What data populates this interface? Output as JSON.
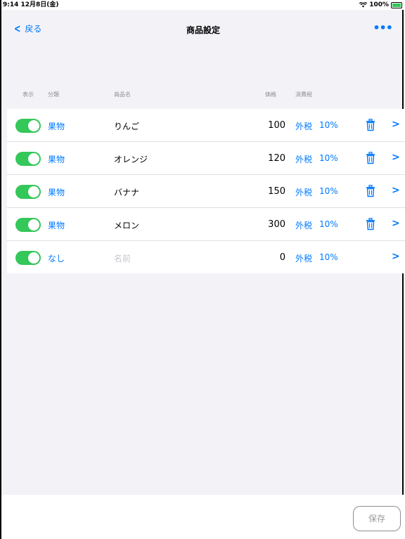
{
  "status": {
    "time": "9:14  12月8日(金)",
    "battery": "100%",
    "wifi_icon": "wifi-icon"
  },
  "nav": {
    "back_label": "戻る",
    "title": "商品設定",
    "more": "•••"
  },
  "headers": {
    "show": "表示",
    "category": "分類",
    "name": "商品名",
    "price": "価格",
    "tax": "消費税"
  },
  "rows": [
    {
      "enabled": true,
      "category": "果物",
      "name": "りんご",
      "price": "100",
      "tax_type": "外税",
      "tax_rate": "10%",
      "deletable": true
    },
    {
      "enabled": true,
      "category": "果物",
      "name": "オレンジ",
      "price": "120",
      "tax_type": "外税",
      "tax_rate": "10%",
      "deletable": true
    },
    {
      "enabled": true,
      "category": "果物",
      "name": "バナナ",
      "price": "150",
      "tax_type": "外税",
      "tax_rate": "10%",
      "deletable": true
    },
    {
      "enabled": true,
      "category": "果物",
      "name": "メロン",
      "price": "300",
      "tax_type": "外税",
      "tax_rate": "10%",
      "deletable": true
    },
    {
      "enabled": true,
      "category": "なし",
      "name": "",
      "name_placeholder": "名前",
      "price": "0",
      "tax_type": "外税",
      "tax_rate": "10%",
      "deletable": false
    }
  ],
  "save_label": "保存",
  "colors": {
    "accent": "#007aff",
    "toggle_on": "#34c759",
    "background": "#f2f2f7"
  }
}
